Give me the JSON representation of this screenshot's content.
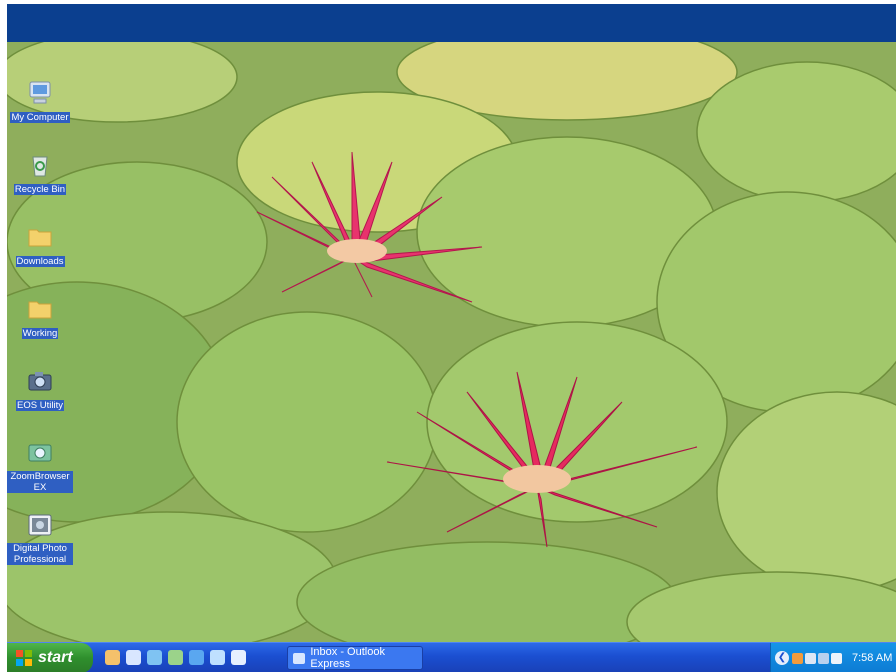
{
  "desktop": {
    "icons": [
      {
        "label": "My Computer",
        "icon": "computer-icon"
      },
      {
        "label": "Recycle Bin",
        "icon": "recycle-bin-icon"
      },
      {
        "label": "Downloads",
        "icon": "folder-icon"
      },
      {
        "label": "Working",
        "icon": "folder-icon"
      },
      {
        "label": "EOS Utility",
        "icon": "camera-icon"
      },
      {
        "label": "ZoomBrowser EX",
        "icon": "zoombrowser-icon"
      },
      {
        "label": "Digital Photo Professional",
        "icon": "camera-photo-icon"
      }
    ],
    "wallpaper": "water lilies"
  },
  "taskbar": {
    "start_label": "start",
    "quick_launch": [
      "running-man-icon",
      "mail-icon",
      "globe-icon",
      "network-icon",
      "browser-icon",
      "search-icon",
      "messenger-icon"
    ],
    "task_label": "Inbox - Outlook Express",
    "clock": "7:58 AM"
  },
  "colors": {
    "titlebar": "#0b3f8f",
    "taskbar": "#1b4fd1",
    "start": "#2f8f2d",
    "tray": "#0d7bd3"
  }
}
